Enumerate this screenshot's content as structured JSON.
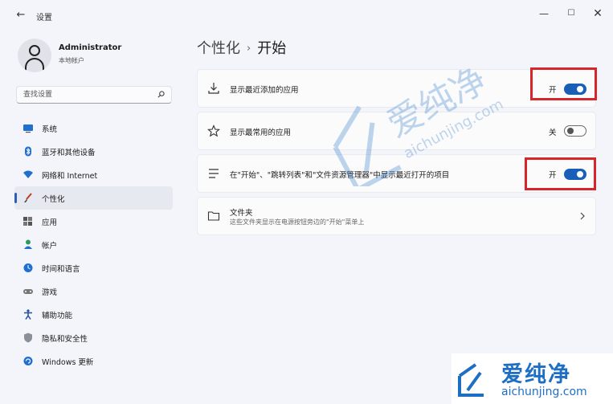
{
  "window": {
    "title": "设置",
    "back_glyph": "←",
    "minimize_glyph": "—",
    "maximize_glyph": "☐",
    "close_glyph": "✕"
  },
  "profile": {
    "name": "Administrator",
    "account_type": "本地帐户"
  },
  "search": {
    "placeholder": "查找设置"
  },
  "sidebar": {
    "items": [
      {
        "label": "系统",
        "icon": "monitor-icon"
      },
      {
        "label": "蓝牙和其他设备",
        "icon": "bluetooth-icon"
      },
      {
        "label": "网络和 Internet",
        "icon": "wifi-icon"
      },
      {
        "label": "个性化",
        "icon": "brush-icon",
        "active": true
      },
      {
        "label": "应用",
        "icon": "apps-icon"
      },
      {
        "label": "帐户",
        "icon": "person-icon"
      },
      {
        "label": "时间和语言",
        "icon": "clock-globe-icon"
      },
      {
        "label": "游戏",
        "icon": "gamepad-icon"
      },
      {
        "label": "辅助功能",
        "icon": "accessibility-icon"
      },
      {
        "label": "隐私和安全性",
        "icon": "shield-icon"
      },
      {
        "label": "Windows 更新",
        "icon": "update-icon"
      }
    ]
  },
  "breadcrumb": {
    "parent": "个性化",
    "separator": "›",
    "current": "开始"
  },
  "settings": [
    {
      "title": "显示最近添加的应用",
      "icon": "download-icon",
      "state_label": "开",
      "on": true
    },
    {
      "title": "显示最常用的应用",
      "icon": "star-icon",
      "state_label": "关",
      "on": false
    },
    {
      "title": "在\"开始\"、\"跳转列表\"和\"文件资源管理器\"中显示最近打开的项目",
      "icon": "list-icon",
      "state_label": "开",
      "on": true
    },
    {
      "title": "文件夹",
      "subtitle": "这些文件夹显示在电源按钮旁边的\"开始\"菜单上",
      "icon": "folder-icon"
    }
  ],
  "watermark": {
    "text": "爱纯净",
    "url": "aichunjing.com"
  },
  "colors": {
    "accent": "#195fb8",
    "highlight": "#d7262b",
    "watermark": "#1e6fc4"
  }
}
